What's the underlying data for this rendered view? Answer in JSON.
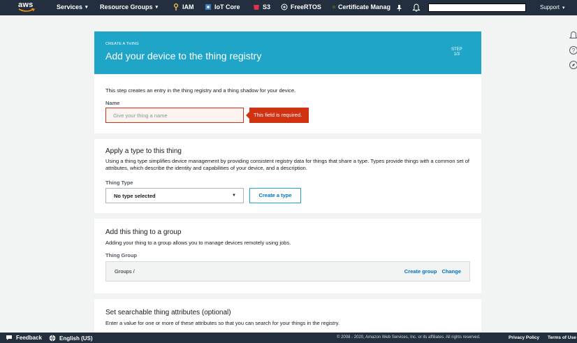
{
  "nav": {
    "logo": "aws",
    "services": "Services",
    "resource_groups": "Resource Groups",
    "shortcuts": [
      {
        "label": "IAM",
        "icon": "iam-icon",
        "color": "#dd344c"
      },
      {
        "label": "IoT Core",
        "icon": "iot-core-icon",
        "color": "#3f8624"
      },
      {
        "label": "S3",
        "icon": "s3-icon",
        "color": "#dd344c"
      },
      {
        "label": "FreeRTOS",
        "icon": "freertos-icon",
        "color": "#ffffff"
      },
      {
        "label": "Certificate Manag",
        "icon": "certificate-manager-icon",
        "color": "#3f8624"
      }
    ],
    "support": "Support"
  },
  "card": {
    "eyebrow": "CREATE A THING",
    "title": "Add your device to the thing registry",
    "step_label": "STEP",
    "step_value": "1/3"
  },
  "name_section": {
    "description": "This step creates an entry in the thing registry and a thing shadow for your device.",
    "label": "Name",
    "placeholder": "Give your thing a name",
    "error": "This field is required."
  },
  "type_section": {
    "title": "Apply a type to this thing",
    "description": "Using a thing type simplifies device management by providing consistent registry data for things that share a type. Types provide things with a common set of attributes, which describe the identity and capabilities of your device, and a description.",
    "label": "Thing Type",
    "selected": "No type selected",
    "create_button": "Create a type"
  },
  "group_section": {
    "title": "Add this thing to a group",
    "description": "Adding your thing to a group allows you to manage devices remotely using jobs.",
    "label": "Thing Group",
    "path": "Groups /",
    "create_group": "Create group",
    "change": "Change"
  },
  "attributes_section": {
    "title": "Set searchable thing attributes (optional)",
    "description": "Enter a value for one or more of these attributes so that you can search for your things in the registry."
  },
  "footer": {
    "feedback": "Feedback",
    "language": "English (US)",
    "copyright": "© 2008 - 2020, Amazon Web Services, Inc. or its affiliates. All rights reserved.",
    "privacy": "Privacy Policy",
    "terms": "Terms of Use"
  },
  "colors": {
    "nav_bg": "#232f3e",
    "header_bg": "#1fa5c8",
    "error": "#d13212",
    "link": "#0073bb"
  }
}
